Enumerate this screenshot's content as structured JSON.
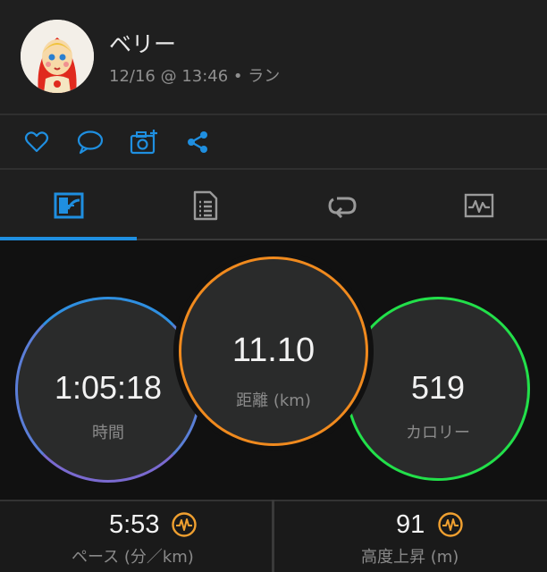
{
  "header": {
    "user_name": "ベリー",
    "activity_meta": "12/16 @ 13:46 • ラン"
  },
  "actions": [
    {
      "icon": "heart-icon"
    },
    {
      "icon": "comment-icon"
    },
    {
      "icon": "add-photo-icon"
    },
    {
      "icon": "share-icon"
    }
  ],
  "tabs": [
    {
      "icon": "overview-icon",
      "active": true
    },
    {
      "icon": "details-list-icon",
      "active": false
    },
    {
      "icon": "laps-icon",
      "active": false
    },
    {
      "icon": "charts-icon",
      "active": false
    }
  ],
  "colors": {
    "accent": "#1f8fe0",
    "time_ring_top": "#2f8fe0",
    "time_ring_bottom": "#7a6ad0",
    "distance_ring": "#f08a1e",
    "calories_ring": "#22e04a",
    "metric_icon": "#f0a030"
  },
  "stats": {
    "time": {
      "value": "1:05:18",
      "label": "時間"
    },
    "distance": {
      "value": "11.10",
      "label": "距離 (km)"
    },
    "calories": {
      "value": "519",
      "label": "カロリー"
    }
  },
  "metrics": {
    "pace": {
      "value": "5:53",
      "label": "ペース (分／km)",
      "icon": "performance-icon"
    },
    "elevation": {
      "value": "91",
      "label": "高度上昇 (m)",
      "icon": "performance-icon"
    }
  }
}
